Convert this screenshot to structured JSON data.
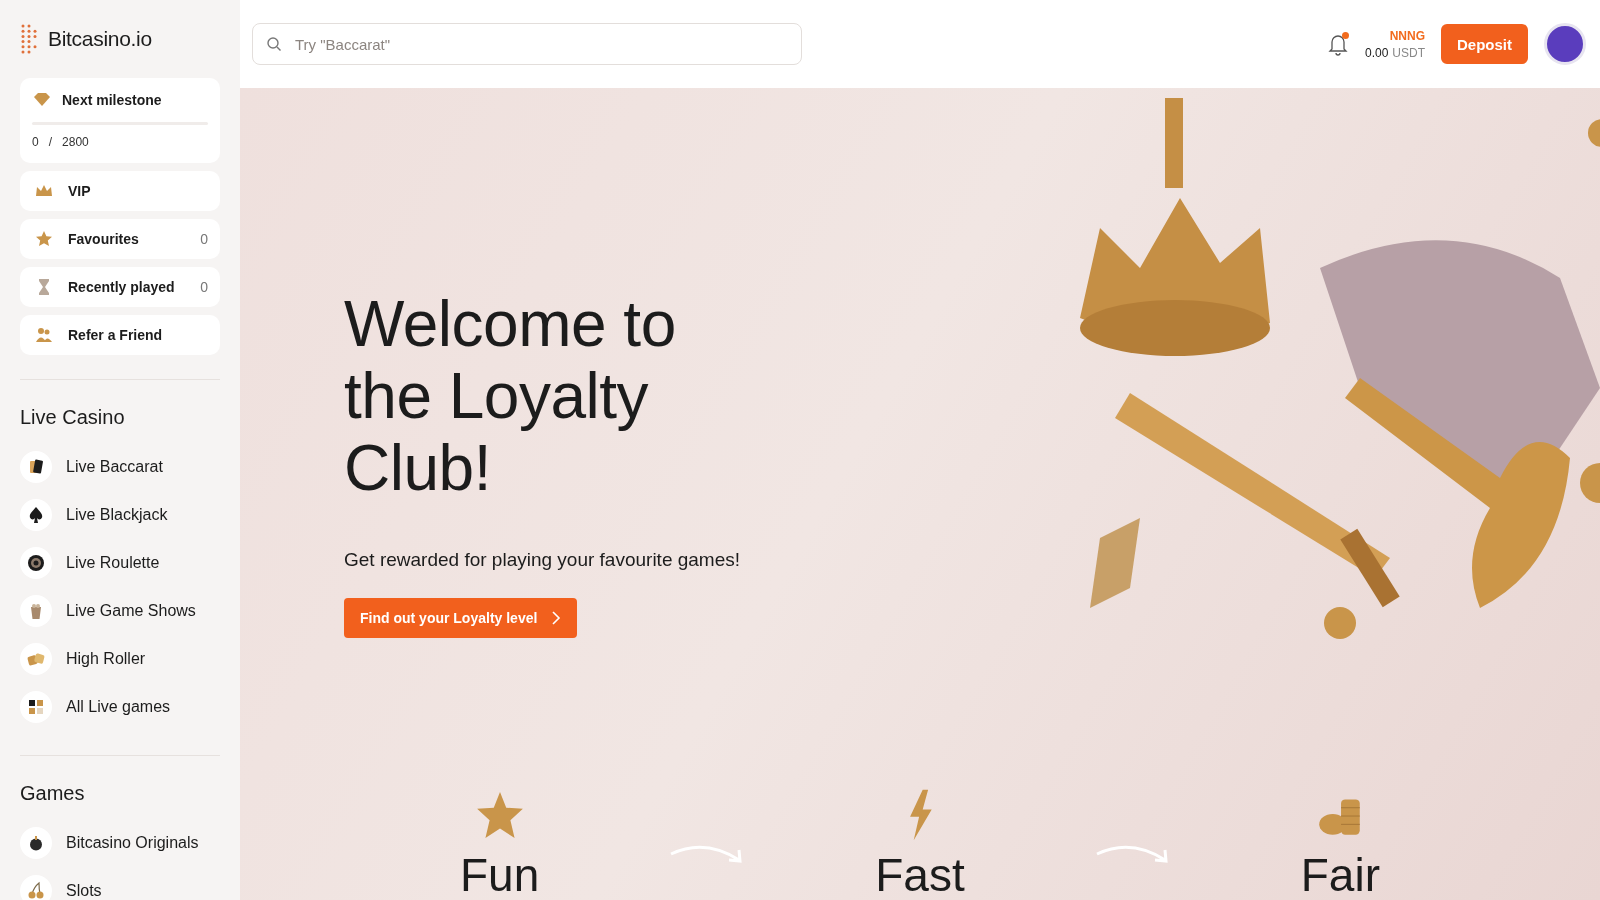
{
  "brand": {
    "name": "Bitcasino.io"
  },
  "search": {
    "placeholder": "Try \"Baccarat\""
  },
  "account": {
    "username": "NNNG",
    "balance": "0.00",
    "currency": "USDT",
    "notification_dot": true,
    "deposit_label": "Deposit"
  },
  "milestone": {
    "title": "Next milestone",
    "current": "0",
    "separator": "/",
    "target": "2800",
    "level": 0
  },
  "quick_links": [
    {
      "kind": "crown",
      "label": "VIP"
    },
    {
      "kind": "star",
      "label": "Favourites",
      "count": "0"
    },
    {
      "kind": "hourglass",
      "label": "Recently played",
      "count": "0"
    },
    {
      "kind": "friends",
      "label": "Refer a Friend"
    }
  ],
  "sections": [
    {
      "title": "Live Casino",
      "items": [
        {
          "kind": "cards",
          "label": "Live Baccarat"
        },
        {
          "kind": "spade",
          "label": "Live Blackjack"
        },
        {
          "kind": "roulette",
          "label": "Live Roulette"
        },
        {
          "kind": "popcorn",
          "label": "Live Game Shows"
        },
        {
          "kind": "dice",
          "label": "High Roller"
        },
        {
          "kind": "grid",
          "label": "All Live games"
        }
      ]
    },
    {
      "title": "Games",
      "items": [
        {
          "kind": "bomb",
          "label": "Bitcasino Originals"
        },
        {
          "kind": "cherry",
          "label": "Slots"
        }
      ]
    }
  ],
  "hero": {
    "title": "Welcome to the Loyalty Club!",
    "subtitle": "Get rewarded for playing your favourite games!",
    "cta": "Find out your Loyalty level"
  },
  "features": [
    {
      "kind": "star",
      "label": "Fun"
    },
    {
      "kind": "bolt",
      "label": "Fast"
    },
    {
      "kind": "coins",
      "label": "Fair"
    }
  ]
}
